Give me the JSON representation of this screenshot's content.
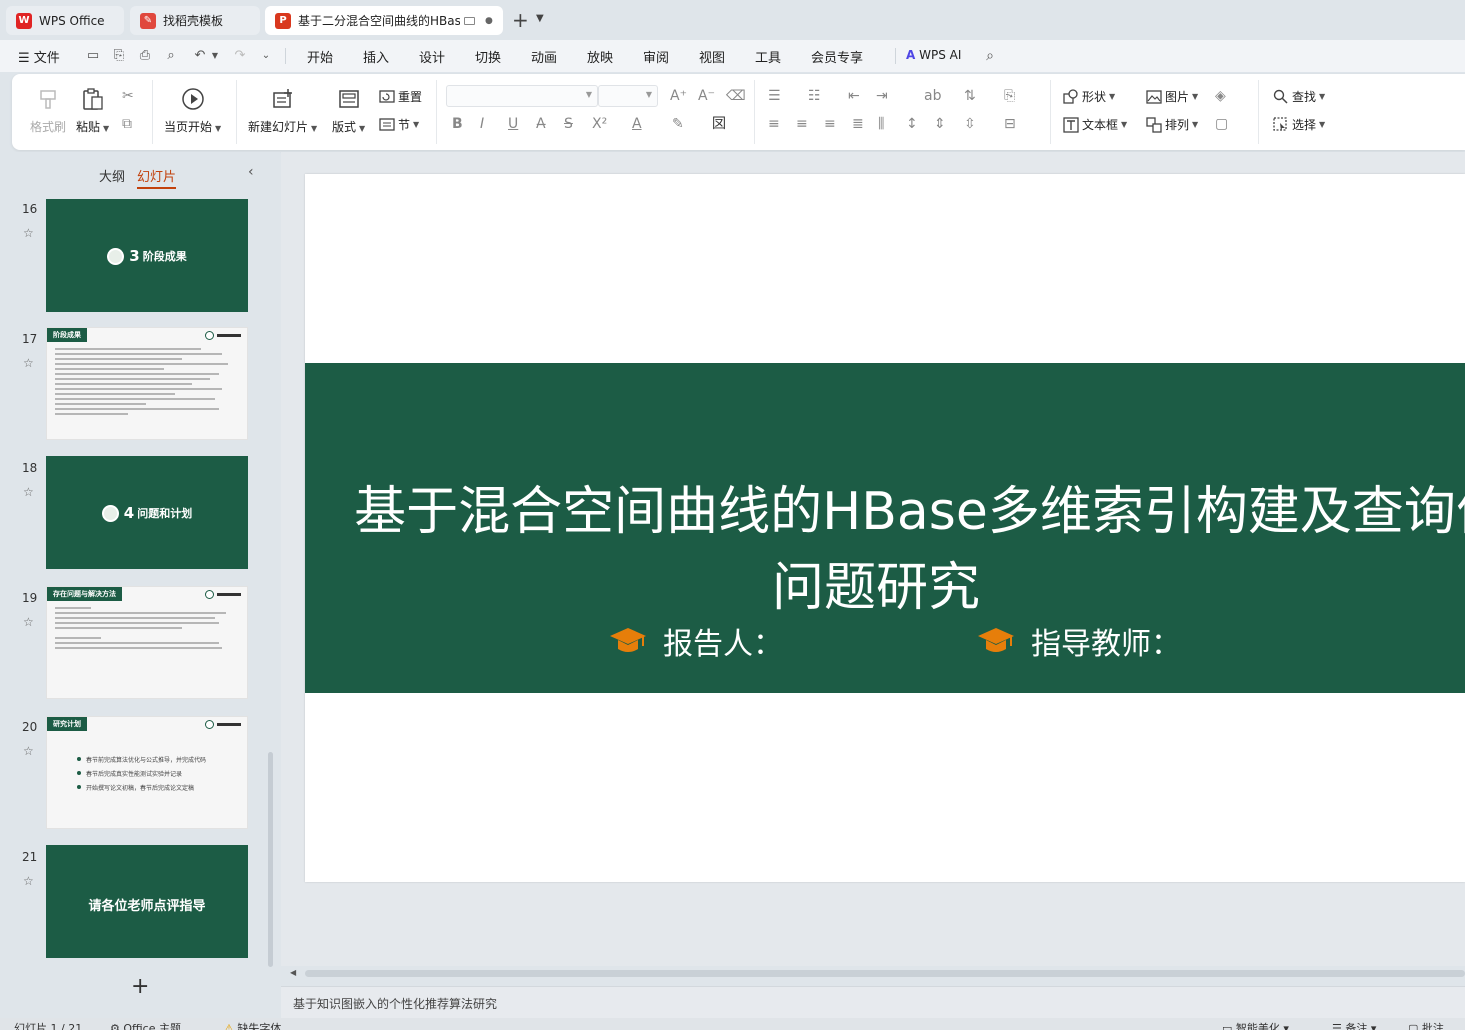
{
  "tabs": [
    {
      "label": "WPS Office",
      "icon": "wps-logo-icon",
      "color": "#e02424"
    },
    {
      "label": "找稻壳模板",
      "icon": "docer-icon",
      "color": "#e0483d"
    },
    {
      "label": "基于二分混合空间曲线的HBas",
      "icon": "presentation-icon",
      "color": "#d9381e"
    }
  ],
  "menu": {
    "file": "文件",
    "items": [
      "开始",
      "插入",
      "设计",
      "切换",
      "动画",
      "放映",
      "审阅",
      "视图",
      "工具",
      "会员专享"
    ],
    "active": "开始",
    "wps_ai": "WPS AI"
  },
  "ribbon": {
    "format_painter": "格式刷",
    "paste": "粘贴",
    "play_from_current": "当页开始",
    "new_slide": "新建幻灯片",
    "layout": "版式",
    "reset": "重置",
    "section": "节",
    "shape": "形状",
    "picture": "图片",
    "textbox": "文本框",
    "arrange": "排列",
    "find": "查找",
    "select": "选择"
  },
  "panel": {
    "outline_tab": "大纲",
    "slides_tab": "幻灯片",
    "slides": [
      {
        "num": "16",
        "kind": "section",
        "number": "3",
        "title": "阶段成果"
      },
      {
        "num": "17",
        "kind": "content",
        "banner": "阶段成果"
      },
      {
        "num": "18",
        "kind": "section",
        "number": "4",
        "title": "问题和计划"
      },
      {
        "num": "19",
        "kind": "content",
        "banner": "存在问题与解决方法"
      },
      {
        "num": "20",
        "kind": "bullets",
        "banner": "研究计划",
        "bullets": [
          "春节前完成算法优化与公式推导，并完成代码",
          "春节后完成真实性能测试实验并记录",
          "开始撰写论文初稿，春节后完成论文定稿"
        ]
      },
      {
        "num": "21",
        "kind": "end",
        "title": "请各位老师点评指导"
      }
    ]
  },
  "slide": {
    "title_line1": "基于混合空间曲线的HBase多维索引构建及查询优",
    "title_line2": "问题研究",
    "reporter": "报告人：",
    "advisor": "指导教师：",
    "band_color": "#1c5c45",
    "icon_color": "#e67e0a"
  },
  "notes": {
    "text": "基于知识图嵌入的个性化推荐算法研究"
  },
  "status": {
    "slide_count": "幻灯片 1 / 21",
    "theme": "Office 主题",
    "missing_font": "缺失字体",
    "smart_beautify": "智能美化",
    "notes": "备注",
    "comments": "批注"
  }
}
